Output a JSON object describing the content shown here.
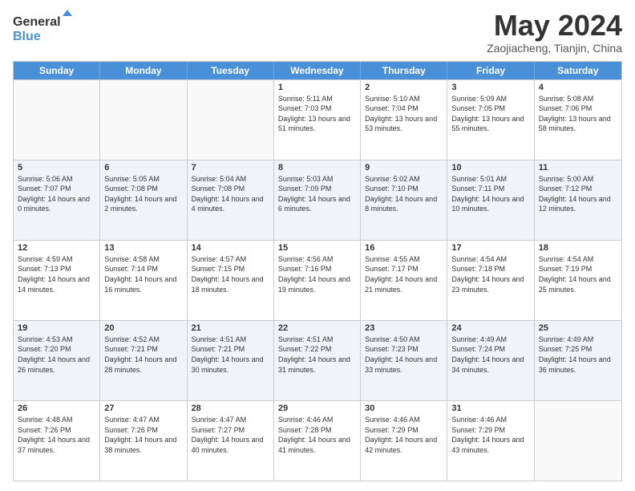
{
  "header": {
    "logo_line1": "General",
    "logo_line2": "Blue",
    "month": "May 2024",
    "location": "Zaojiacheng, Tianjin, China"
  },
  "days_of_week": [
    "Sunday",
    "Monday",
    "Tuesday",
    "Wednesday",
    "Thursday",
    "Friday",
    "Saturday"
  ],
  "weeks": [
    [
      {
        "day": "",
        "sunrise": "",
        "sunset": "",
        "daylight": ""
      },
      {
        "day": "",
        "sunrise": "",
        "sunset": "",
        "daylight": ""
      },
      {
        "day": "",
        "sunrise": "",
        "sunset": "",
        "daylight": ""
      },
      {
        "day": "1",
        "sunrise": "Sunrise: 5:11 AM",
        "sunset": "Sunset: 7:03 PM",
        "daylight": "Daylight: 13 hours and 51 minutes."
      },
      {
        "day": "2",
        "sunrise": "Sunrise: 5:10 AM",
        "sunset": "Sunset: 7:04 PM",
        "daylight": "Daylight: 13 hours and 53 minutes."
      },
      {
        "day": "3",
        "sunrise": "Sunrise: 5:09 AM",
        "sunset": "Sunset: 7:05 PM",
        "daylight": "Daylight: 13 hours and 55 minutes."
      },
      {
        "day": "4",
        "sunrise": "Sunrise: 5:08 AM",
        "sunset": "Sunset: 7:06 PM",
        "daylight": "Daylight: 13 hours and 58 minutes."
      }
    ],
    [
      {
        "day": "5",
        "sunrise": "Sunrise: 5:06 AM",
        "sunset": "Sunset: 7:07 PM",
        "daylight": "Daylight: 14 hours and 0 minutes."
      },
      {
        "day": "6",
        "sunrise": "Sunrise: 5:05 AM",
        "sunset": "Sunset: 7:08 PM",
        "daylight": "Daylight: 14 hours and 2 minutes."
      },
      {
        "day": "7",
        "sunrise": "Sunrise: 5:04 AM",
        "sunset": "Sunset: 7:08 PM",
        "daylight": "Daylight: 14 hours and 4 minutes."
      },
      {
        "day": "8",
        "sunrise": "Sunrise: 5:03 AM",
        "sunset": "Sunset: 7:09 PM",
        "daylight": "Daylight: 14 hours and 6 minutes."
      },
      {
        "day": "9",
        "sunrise": "Sunrise: 5:02 AM",
        "sunset": "Sunset: 7:10 PM",
        "daylight": "Daylight: 14 hours and 8 minutes."
      },
      {
        "day": "10",
        "sunrise": "Sunrise: 5:01 AM",
        "sunset": "Sunset: 7:11 PM",
        "daylight": "Daylight: 14 hours and 10 minutes."
      },
      {
        "day": "11",
        "sunrise": "Sunrise: 5:00 AM",
        "sunset": "Sunset: 7:12 PM",
        "daylight": "Daylight: 14 hours and 12 minutes."
      }
    ],
    [
      {
        "day": "12",
        "sunrise": "Sunrise: 4:59 AM",
        "sunset": "Sunset: 7:13 PM",
        "daylight": "Daylight: 14 hours and 14 minutes."
      },
      {
        "day": "13",
        "sunrise": "Sunrise: 4:58 AM",
        "sunset": "Sunset: 7:14 PM",
        "daylight": "Daylight: 14 hours and 16 minutes."
      },
      {
        "day": "14",
        "sunrise": "Sunrise: 4:57 AM",
        "sunset": "Sunset: 7:15 PM",
        "daylight": "Daylight: 14 hours and 18 minutes."
      },
      {
        "day": "15",
        "sunrise": "Sunrise: 4:56 AM",
        "sunset": "Sunset: 7:16 PM",
        "daylight": "Daylight: 14 hours and 19 minutes."
      },
      {
        "day": "16",
        "sunrise": "Sunrise: 4:55 AM",
        "sunset": "Sunset: 7:17 PM",
        "daylight": "Daylight: 14 hours and 21 minutes."
      },
      {
        "day": "17",
        "sunrise": "Sunrise: 4:54 AM",
        "sunset": "Sunset: 7:18 PM",
        "daylight": "Daylight: 14 hours and 23 minutes."
      },
      {
        "day": "18",
        "sunrise": "Sunrise: 4:54 AM",
        "sunset": "Sunset: 7:19 PM",
        "daylight": "Daylight: 14 hours and 25 minutes."
      }
    ],
    [
      {
        "day": "19",
        "sunrise": "Sunrise: 4:53 AM",
        "sunset": "Sunset: 7:20 PM",
        "daylight": "Daylight: 14 hours and 26 minutes."
      },
      {
        "day": "20",
        "sunrise": "Sunrise: 4:52 AM",
        "sunset": "Sunset: 7:21 PM",
        "daylight": "Daylight: 14 hours and 28 minutes."
      },
      {
        "day": "21",
        "sunrise": "Sunrise: 4:51 AM",
        "sunset": "Sunset: 7:21 PM",
        "daylight": "Daylight: 14 hours and 30 minutes."
      },
      {
        "day": "22",
        "sunrise": "Sunrise: 4:51 AM",
        "sunset": "Sunset: 7:22 PM",
        "daylight": "Daylight: 14 hours and 31 minutes."
      },
      {
        "day": "23",
        "sunrise": "Sunrise: 4:50 AM",
        "sunset": "Sunset: 7:23 PM",
        "daylight": "Daylight: 14 hours and 33 minutes."
      },
      {
        "day": "24",
        "sunrise": "Sunrise: 4:49 AM",
        "sunset": "Sunset: 7:24 PM",
        "daylight": "Daylight: 14 hours and 34 minutes."
      },
      {
        "day": "25",
        "sunrise": "Sunrise: 4:49 AM",
        "sunset": "Sunset: 7:25 PM",
        "daylight": "Daylight: 14 hours and 36 minutes."
      }
    ],
    [
      {
        "day": "26",
        "sunrise": "Sunrise: 4:48 AM",
        "sunset": "Sunset: 7:26 PM",
        "daylight": "Daylight: 14 hours and 37 minutes."
      },
      {
        "day": "27",
        "sunrise": "Sunrise: 4:47 AM",
        "sunset": "Sunset: 7:26 PM",
        "daylight": "Daylight: 14 hours and 38 minutes."
      },
      {
        "day": "28",
        "sunrise": "Sunrise: 4:47 AM",
        "sunset": "Sunset: 7:27 PM",
        "daylight": "Daylight: 14 hours and 40 minutes."
      },
      {
        "day": "29",
        "sunrise": "Sunrise: 4:46 AM",
        "sunset": "Sunset: 7:28 PM",
        "daylight": "Daylight: 14 hours and 41 minutes."
      },
      {
        "day": "30",
        "sunrise": "Sunrise: 4:46 AM",
        "sunset": "Sunset: 7:29 PM",
        "daylight": "Daylight: 14 hours and 42 minutes."
      },
      {
        "day": "31",
        "sunrise": "Sunrise: 4:46 AM",
        "sunset": "Sunset: 7:29 PM",
        "daylight": "Daylight: 14 hours and 43 minutes."
      },
      {
        "day": "",
        "sunrise": "",
        "sunset": "",
        "daylight": ""
      }
    ]
  ]
}
